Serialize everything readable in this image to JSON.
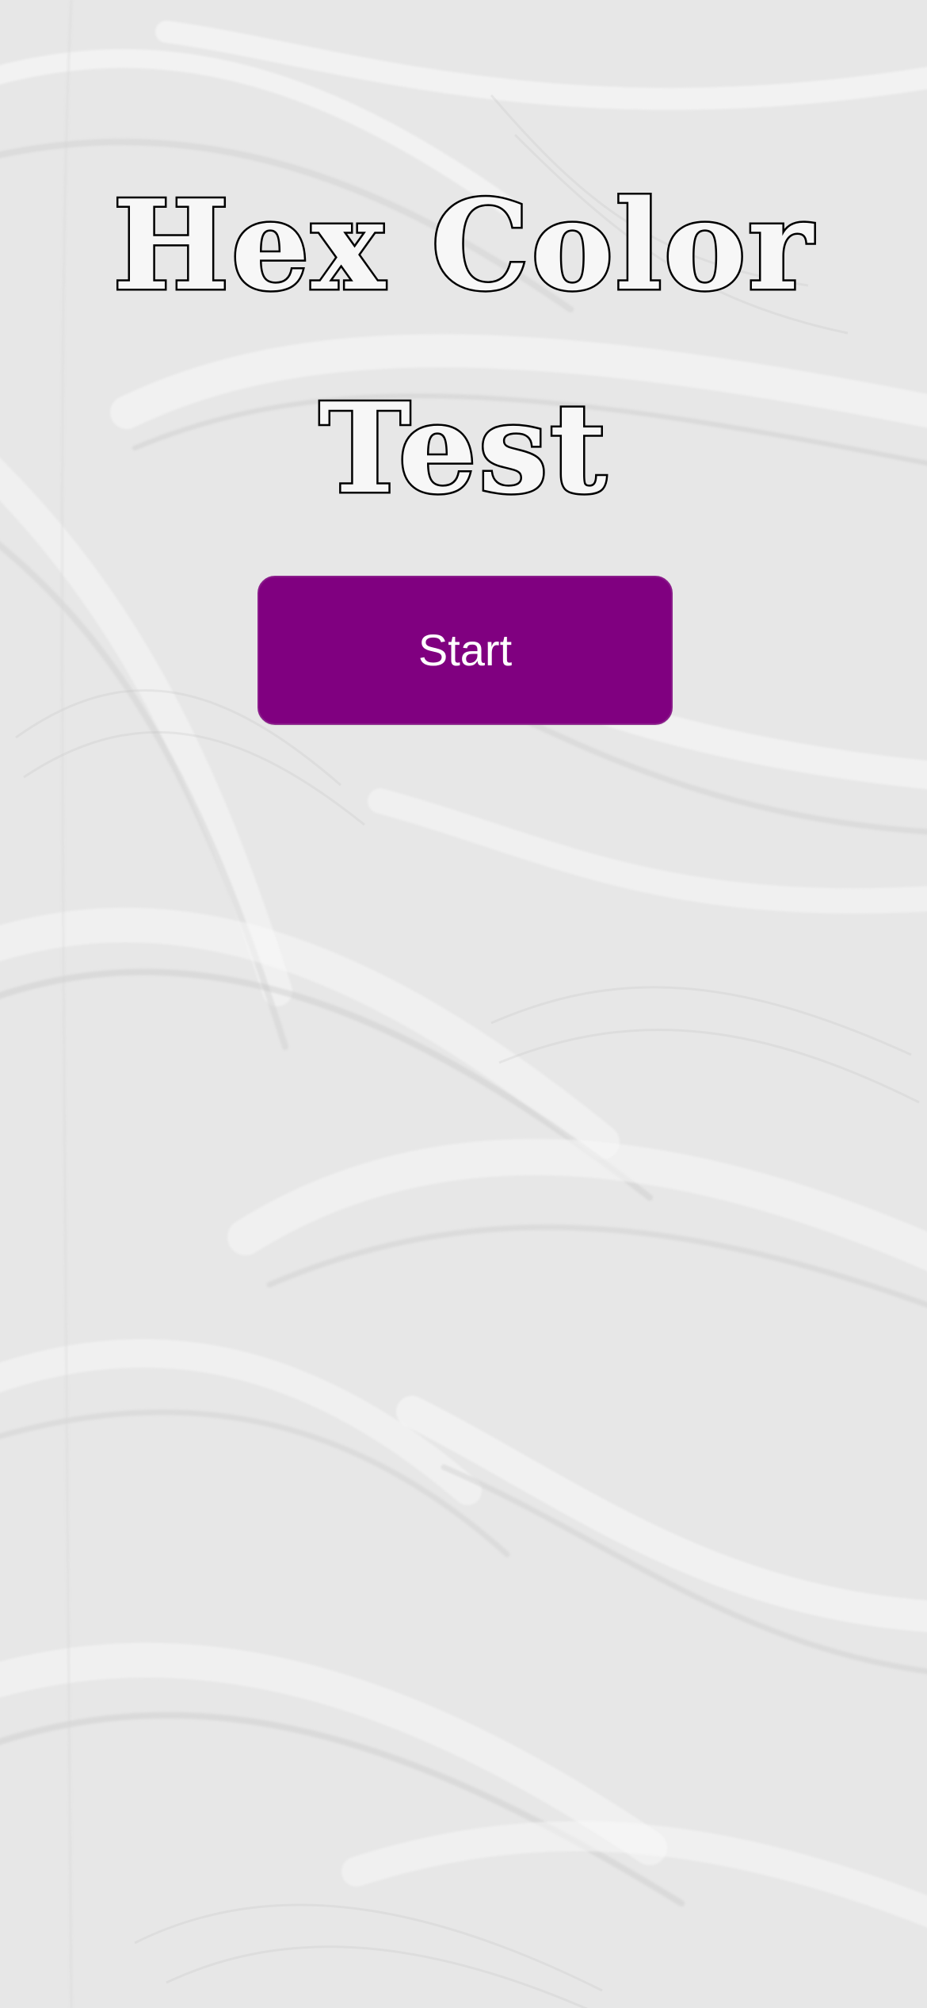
{
  "screen": {
    "background_color": "#e9e9e9"
  },
  "title": {
    "line_1": "Hex Color",
    "line_2": "Test",
    "text_color": "#f7f7f7",
    "outline_color": "#000000"
  },
  "start_button": {
    "label": "Start",
    "background_color": "#800080",
    "text_color": "#ffffff"
  }
}
